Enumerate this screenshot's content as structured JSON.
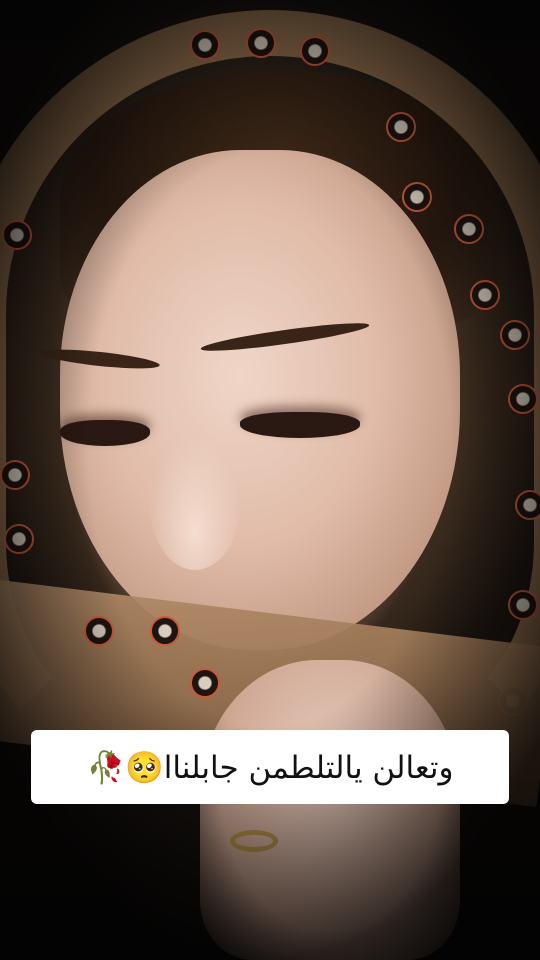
{
  "photo": {
    "subject_icon": "photo-woman-scarf",
    "colors": {
      "background": "#0b0908",
      "scarf": "#a07a55",
      "stitch": "#c85a3a",
      "skin": "#e0bba8"
    }
  },
  "caption": {
    "text": "وتعالن يالتلطمن جابلناا🥺🥀",
    "background": "#ffffff",
    "color": "#111111"
  }
}
